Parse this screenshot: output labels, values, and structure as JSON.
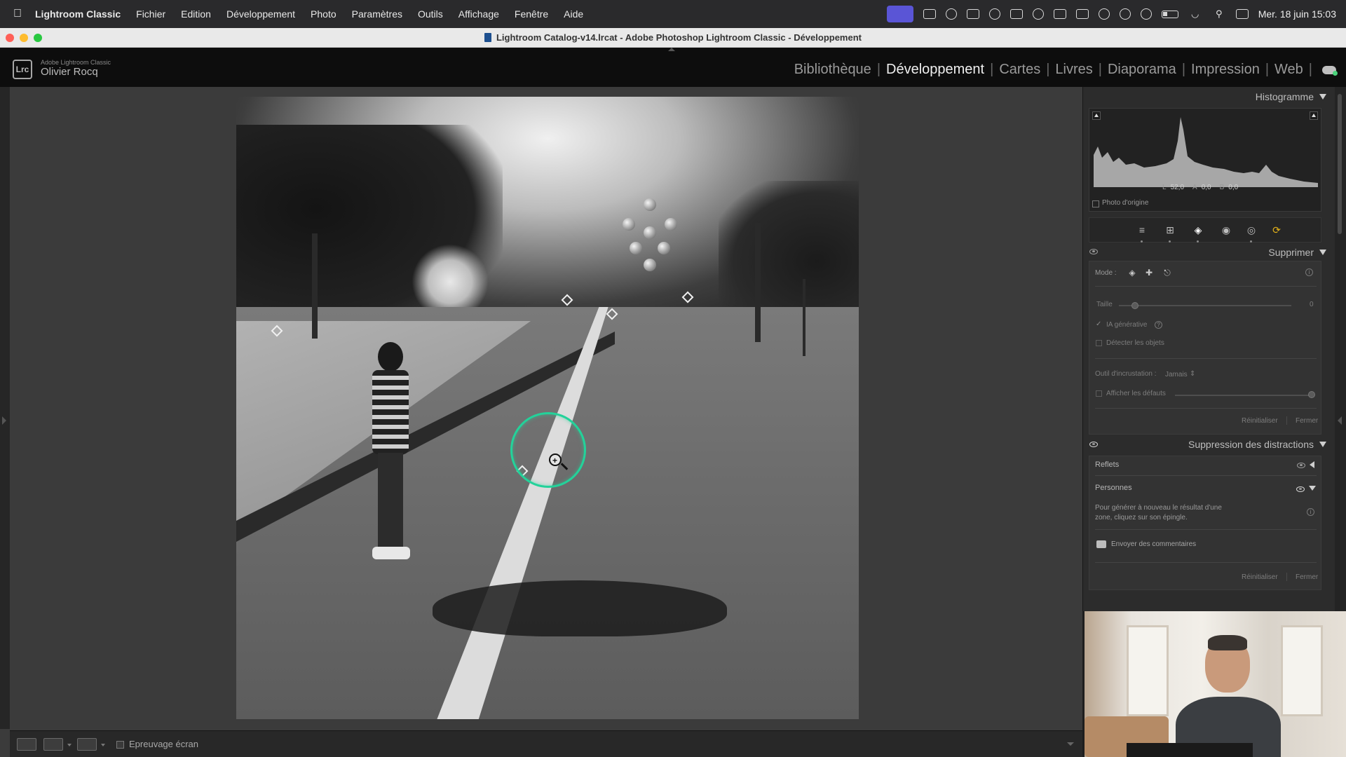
{
  "menubar": {
    "app_name": "Lightroom Classic",
    "items": [
      "Fichier",
      "Edition",
      "Développement",
      "Photo",
      "Paramètres",
      "Outils",
      "Affichage",
      "Fenêtre",
      "Aide"
    ],
    "clock": "Mer. 18 juin  15:03"
  },
  "window": {
    "title": "Lightroom Catalog-v14.lrcat - Adobe Photoshop Lightroom Classic - Développement"
  },
  "header": {
    "logo_text": "Lrc",
    "product": "Adobe Lightroom Classic",
    "user": "Olivier Rocq",
    "modules": [
      "Bibliothèque",
      "Développement",
      "Cartes",
      "Livres",
      "Diaporama",
      "Impression",
      "Web"
    ],
    "active_module": "Développement"
  },
  "histogram": {
    "title": "Histogramme",
    "lab": {
      "l_label": "L",
      "l_value": "52,0",
      "a_label": "A",
      "a_value": "0,0",
      "b_label": "B",
      "b_value": "0,0"
    },
    "original_photo_label": "Photo d'origine"
  },
  "supprimer": {
    "title": "Supprimer",
    "mode_label": "Mode :",
    "size_label": "Taille",
    "size_value": "0",
    "generative_ai_label": "IA générative",
    "generative_ai_checked": true,
    "detect_objects_label": "Détecter les objets",
    "detect_objects_checked": false,
    "overlay_tool_label": "Outil d'incrustation :",
    "overlay_tool_value": "Jamais",
    "show_defaults_label": "Afficher les défauts",
    "reset_label": "Réinitialiser",
    "close_label": "Fermer"
  },
  "distractions": {
    "title": "Suppression des distractions",
    "reflections_label": "Reflets",
    "people_label": "Personnes",
    "help_text": "Pour générer à nouveau le résultat d'une zone, cliquez sur son épingle.",
    "feedback_label": "Envoyer des commentaires",
    "reset_label": "Réinitialiser",
    "close_label": "Fermer"
  },
  "bottom_bar": {
    "soft_proof_label": "Epreuvage écran",
    "soft_proof_checked": false
  },
  "colors": {
    "brush_ring": "#23d29a",
    "ai_tool": "#e5b319",
    "active_status": "#5a55d6"
  }
}
